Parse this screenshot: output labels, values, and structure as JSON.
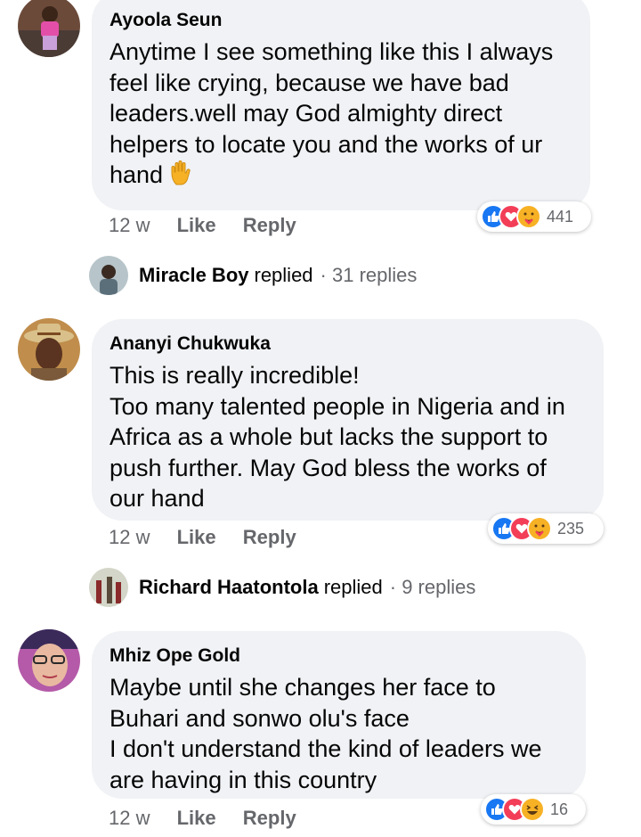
{
  "comments": [
    {
      "author": "Ayoola Seun",
      "text": "Anytime I see something like this I always feel like crying, because we have bad leaders.well may God almighty direct helpers to  locate you and the works of ur hand",
      "emoji": "raised-hand",
      "time": "12 w",
      "like_label": "Like",
      "reply_label": "Reply",
      "reaction_count": "441",
      "reactions": [
        "like",
        "love",
        "care"
      ],
      "replied_by": "Miracle Boy",
      "replied_word": "replied",
      "replies_count": "· 31 replies"
    },
    {
      "author": "Ananyi Chukwuka",
      "text": "This is really incredible!\nToo many talented people in Nigeria and in Africa as a whole but lacks the support to push further. May God bless the works of our hand",
      "time": "12 w",
      "like_label": "Like",
      "reply_label": "Reply",
      "reaction_count": "235",
      "reactions": [
        "like",
        "love",
        "care"
      ],
      "replied_by": "Richard Haatontola",
      "replied_word": "replied",
      "replies_count": "· 9 replies"
    },
    {
      "author": "Mhiz Ope Gold",
      "text": "Maybe until she changes her face to Buhari and sonwo olu's face\nI don't understand the kind of leaders we are having in this country",
      "time": "12 w",
      "like_label": "Like",
      "reply_label": "Reply",
      "reaction_count": "16",
      "reactions": [
        "like",
        "love",
        "haha"
      ]
    }
  ],
  "colors": {
    "bubble": "#f0f2f5",
    "meta": "#65676b",
    "like": "#1877f2",
    "love": "#f33e58",
    "emoji": "#f7b125"
  }
}
